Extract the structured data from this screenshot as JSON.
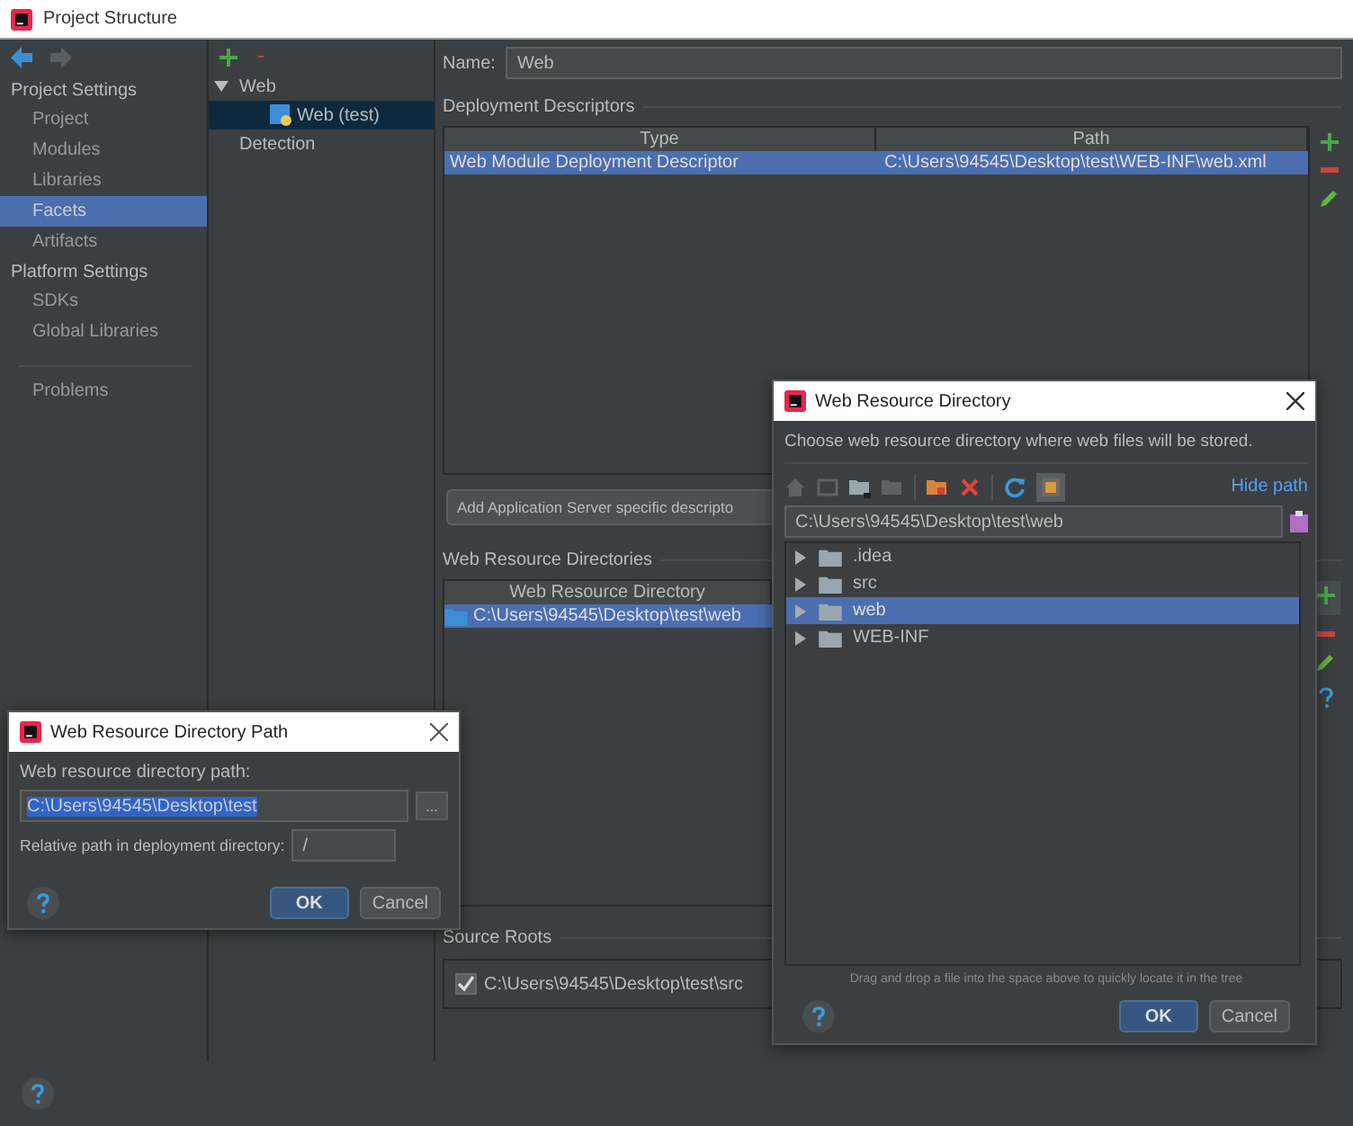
{
  "window": {
    "title": "Project Structure"
  },
  "sidebar": {
    "sections": [
      {
        "label": "Project Settings",
        "items": [
          {
            "label": "Project",
            "selected": false
          },
          {
            "label": "Modules",
            "selected": false
          },
          {
            "label": "Libraries",
            "selected": false
          },
          {
            "label": "Facets",
            "selected": true
          },
          {
            "label": "Artifacts",
            "selected": false
          }
        ]
      },
      {
        "label": "Platform Settings",
        "items": [
          {
            "label": "SDKs",
            "selected": false
          },
          {
            "label": "Global Libraries",
            "selected": false
          }
        ]
      }
    ],
    "extra_items": [
      {
        "label": "Problems",
        "selected": false
      }
    ]
  },
  "facet_tree": [
    {
      "label": "Web",
      "expanded": true,
      "selected": false,
      "children": [
        {
          "label": "Web (test)",
          "selected": true
        }
      ]
    },
    {
      "label": "Detection",
      "selected": false
    }
  ],
  "name_field": {
    "label": "Name:",
    "value": "Web"
  },
  "deployment_descriptors": {
    "title": "Deployment Descriptors",
    "columns": [
      "Type",
      "Path"
    ],
    "rows": [
      {
        "cells": [
          "Web Module Deployment Descriptor",
          "C:\\Users\\94545\\Desktop\\test\\WEB-INF\\web.xml"
        ],
        "selected": true
      }
    ]
  },
  "add_server_button": "Add Application Server specific descripto",
  "web_resource_directories": {
    "title": "Web Resource Directories",
    "columns": [
      "Web Resource Directory"
    ],
    "rows": [
      {
        "path": "C:\\Users\\94545\\Desktop\\test\\web",
        "selected": true
      }
    ]
  },
  "source_roots": {
    "title": "Source Roots",
    "items": [
      {
        "path": "C:\\Users\\94545\\Desktop\\test\\src",
        "checked": true
      }
    ]
  },
  "directory_dialog": {
    "title": "Web Resource Directory",
    "description": "Choose web resource directory where web files will be stored.",
    "hide_path_link": "Hide path",
    "path": "C:\\Users\\94545\\Desktop\\test\\web",
    "tree": [
      {
        "label": ".idea",
        "selected": false
      },
      {
        "label": "src",
        "selected": false
      },
      {
        "label": "web",
        "selected": true
      },
      {
        "label": "WEB-INF",
        "selected": false
      }
    ],
    "hint": "Drag and drop a file into the space above to quickly locate it in the tree",
    "buttons": [
      "OK",
      "Cancel"
    ]
  },
  "path_dialog": {
    "title": "Web Resource Directory Path",
    "path_label": "Web resource directory path:",
    "path_value": "C:\\Users\\94545\\Desktop\\test",
    "browse_button": "...",
    "relative_label": "Relative path in deployment directory:",
    "relative_value": "/",
    "buttons": [
      "OK",
      "Cancel"
    ]
  }
}
